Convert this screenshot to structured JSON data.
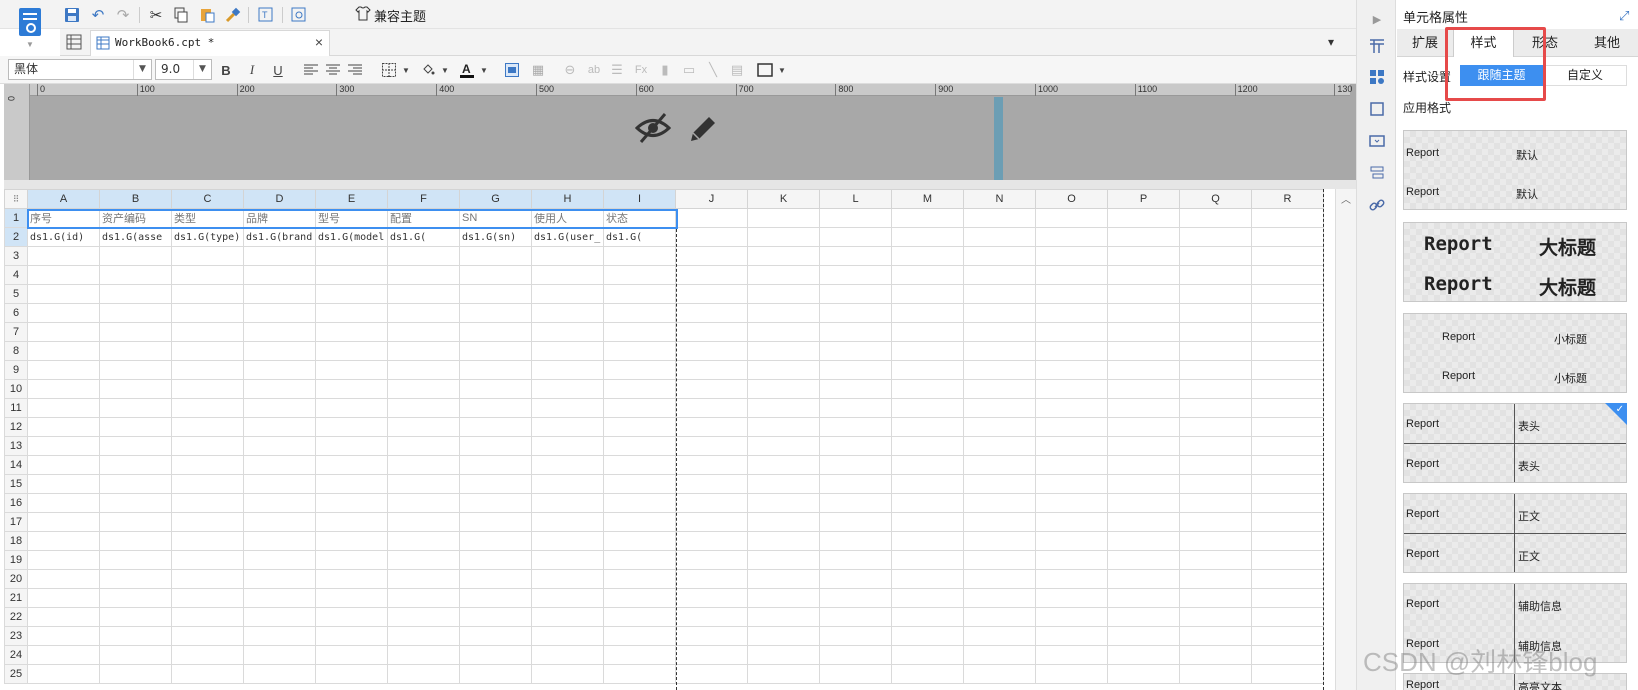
{
  "toolbar": {
    "compat_theme_label": "兼容主题"
  },
  "tabs": {
    "workbook_title": "WorkBook6.cpt *"
  },
  "format": {
    "font_name": "黑体",
    "font_size": "9.0",
    "bold": "B",
    "italic": "I",
    "underline": "U"
  },
  "ruler": {
    "ticks": [
      "0",
      "100",
      "200",
      "300",
      "400",
      "500",
      "600",
      "700",
      "800",
      "900",
      "1000",
      "1100",
      "1200",
      "130"
    ],
    "left_label": "0"
  },
  "grid": {
    "columns": [
      "A",
      "B",
      "C",
      "D",
      "E",
      "F",
      "G",
      "H",
      "I",
      "J",
      "K",
      "L",
      "M",
      "N",
      "O",
      "P",
      "Q",
      "R"
    ],
    "rows": [
      "1",
      "2",
      "3",
      "4",
      "5",
      "6",
      "7",
      "8",
      "9",
      "10",
      "11",
      "12",
      "13",
      "14",
      "15",
      "16",
      "17",
      "18",
      "19",
      "20",
      "21",
      "22",
      "23",
      "24",
      "25"
    ],
    "row1": [
      "序号",
      "资产编码",
      "类型",
      "品牌",
      "型号",
      "配置",
      "SN",
      "使用人",
      "状态"
    ],
    "row2": [
      "ds1.G(id)",
      "ds1.G(asse",
      "ds1.G(type)",
      "ds1.G(brand",
      "ds1.G(model",
      "ds1.G(",
      "ds1.G(sn)",
      "ds1.G(user_",
      "ds1.G("
    ]
  },
  "panel": {
    "title": "单元格属性",
    "tabs": [
      "扩展",
      "样式",
      "形态",
      "其他"
    ],
    "style_setting_label": "样式设置",
    "follow_theme": "跟随主题",
    "custom": "自定义",
    "apply_format": "应用格式",
    "styles": [
      {
        "left": "Report",
        "right": "默认"
      },
      {
        "left": "Report",
        "right": "大标题"
      },
      {
        "left": "Report",
        "right": "小标题"
      },
      {
        "left": "Report",
        "right": "表头"
      },
      {
        "left": "Report",
        "right": "正文"
      },
      {
        "left": "Report",
        "right": "辅助信息"
      },
      {
        "left": "Report",
        "right": "高亮文本"
      }
    ]
  },
  "watermark": "CSDN @刘林锋blog",
  "colors": {
    "accent": "#3d8ff0",
    "highlight_box": "#e64a4a",
    "selected_header": "#d0e4f6"
  }
}
